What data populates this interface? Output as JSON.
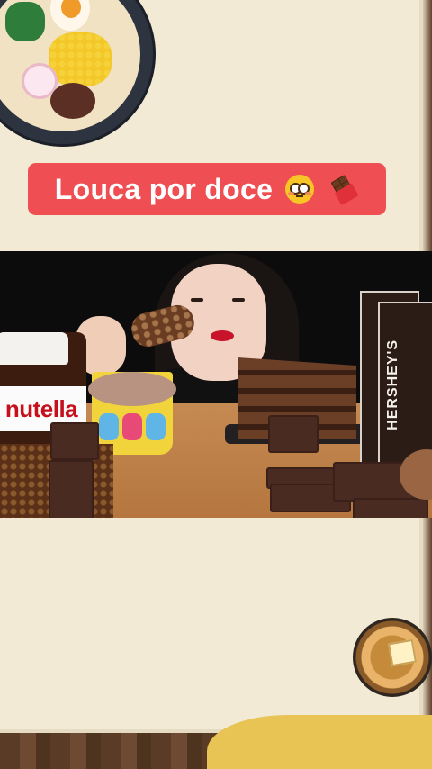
{
  "banner": {
    "title": "Louca por doce",
    "emojis": [
      "flushed-face-icon",
      "chocolate-bar-icon"
    ],
    "background_color": "#ef4f52",
    "text_color": "#ffffff"
  },
  "video": {
    "products": {
      "jar_label": "nutella",
      "milk_box_label": "HERSHEY'S"
    }
  },
  "colors": {
    "paper": "#f3ead6",
    "accent_red": "#ef4f52",
    "wood": "#5a3b25",
    "mustard": "#e7c454"
  }
}
